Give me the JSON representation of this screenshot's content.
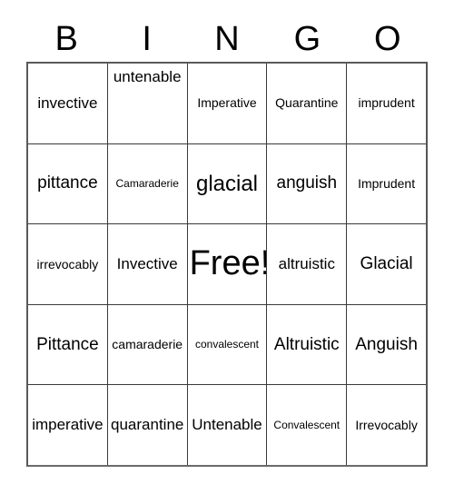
{
  "card": {
    "title": "Bingo Card",
    "header_letters": [
      "B",
      "I",
      "N",
      "G",
      "O"
    ],
    "grid_size": "5x5",
    "free_space_label": "Free!",
    "free_space_position": {
      "row": 3,
      "column": 3
    },
    "colors": {
      "background": "#ffffff",
      "text": "#000000",
      "grid_border": "#3a3a3a",
      "outer_border": "#5a5a5a"
    },
    "rows": [
      [
        {
          "text": "invective",
          "size": "md"
        },
        {
          "text": "untenable",
          "size": "md",
          "align": "top"
        },
        {
          "text": "Imperative",
          "size": "sm"
        },
        {
          "text": "Quarantine",
          "size": "sm"
        },
        {
          "text": "imprudent",
          "size": "sm"
        }
      ],
      [
        {
          "text": "pittance",
          "size": "lg"
        },
        {
          "text": "Camaraderie",
          "size": "xs"
        },
        {
          "text": "glacial",
          "size": "xl"
        },
        {
          "text": "anguish",
          "size": "lg"
        },
        {
          "text": "Imprudent",
          "size": "sm"
        }
      ],
      [
        {
          "text": "irrevocably",
          "size": "sm"
        },
        {
          "text": "Invective",
          "size": "md"
        },
        {
          "text": "Free!",
          "size": "free"
        },
        {
          "text": "altruistic",
          "size": "md"
        },
        {
          "text": "Glacial",
          "size": "lg"
        }
      ],
      [
        {
          "text": "Pittance",
          "size": "lg"
        },
        {
          "text": "camaraderie",
          "size": "sm"
        },
        {
          "text": "convalescent",
          "size": "xs"
        },
        {
          "text": "Altruistic",
          "size": "lg"
        },
        {
          "text": "Anguish",
          "size": "lg"
        }
      ],
      [
        {
          "text": "imperative",
          "size": "md"
        },
        {
          "text": "quarantine",
          "size": "md"
        },
        {
          "text": "Untenable",
          "size": "md"
        },
        {
          "text": "Convalescent",
          "size": "xs"
        },
        {
          "text": "Irrevocably",
          "size": "sm"
        }
      ]
    ]
  }
}
